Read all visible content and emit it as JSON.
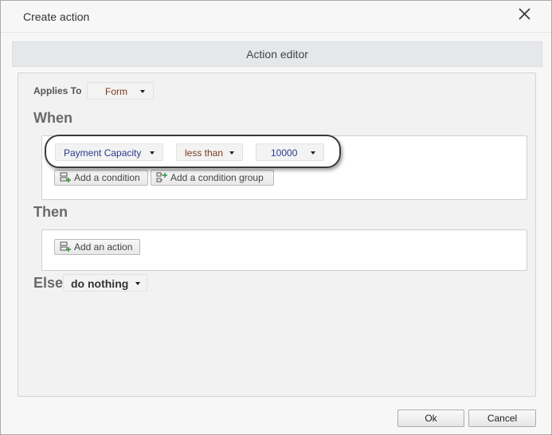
{
  "dialog": {
    "title": "Create action"
  },
  "editor": {
    "header": "Action editor"
  },
  "applies_to": {
    "label": "Applies To",
    "value": "Form"
  },
  "when": {
    "title": "When",
    "condition": {
      "field": "Payment Capacity",
      "operator": "less than",
      "value": "10000"
    },
    "add_condition_label": "Add a condition",
    "add_condition_group_label": "Add a condition group"
  },
  "then": {
    "title": "Then",
    "add_action_label": "Add an action"
  },
  "else": {
    "title": "Else",
    "value": "do nothing"
  },
  "footer": {
    "ok_label": "Ok",
    "cancel_label": "Cancel"
  },
  "colors": {
    "field_text": "#2b3a8c",
    "operator_text": "#7a3a1a",
    "applies_value_text": "#7a3a1a"
  },
  "icons": {
    "close": "close-icon",
    "add_condition": "add-condition-icon",
    "add_group": "add-condition-group-icon",
    "add_action": "add-action-icon"
  }
}
